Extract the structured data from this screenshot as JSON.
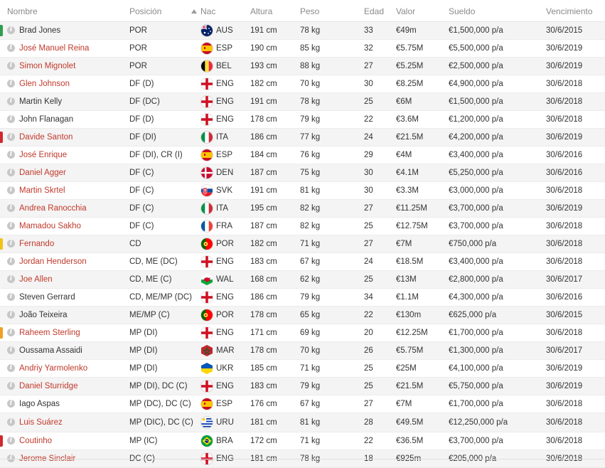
{
  "columns": {
    "name": "Nombre",
    "position": "Posición",
    "nationality": "Nac",
    "height": "Altura",
    "weight": "Peso",
    "age": "Edad",
    "value": "Valor",
    "wage": "Sueldo",
    "expiry": "Vencimiento"
  },
  "colors": {
    "link_name": "#c0392b",
    "plain_name": "#333333",
    "marker_green": "#2e9e4f",
    "marker_red": "#d0282e",
    "marker_yellow": "#f2c21b",
    "marker_orange": "#f0a020"
  },
  "players": [
    {
      "name": "Brad Jones",
      "link": false,
      "marker": "green",
      "position": "POR",
      "nat": "AUS",
      "flag": "aus",
      "height": "191 cm",
      "weight": "78 kg",
      "age": "33",
      "value": "€49m",
      "wage": "€1,500,000 p/a",
      "expiry": "30/6/2015"
    },
    {
      "name": "José Manuel Reina",
      "link": true,
      "marker": "",
      "position": "POR",
      "nat": "ESP",
      "flag": "esp",
      "height": "190 cm",
      "weight": "85 kg",
      "age": "32",
      "value": "€5.75M",
      "wage": "€5,500,000 p/a",
      "expiry": "30/6/2019"
    },
    {
      "name": "Simon Mignolet",
      "link": true,
      "marker": "",
      "position": "POR",
      "nat": "BEL",
      "flag": "bel",
      "height": "193 cm",
      "weight": "88 kg",
      "age": "27",
      "value": "€5.25M",
      "wage": "€2,500,000 p/a",
      "expiry": "30/6/2019"
    },
    {
      "name": "Glen Johnson",
      "link": true,
      "marker": "",
      "position": "DF (D)",
      "nat": "ENG",
      "flag": "eng",
      "height": "182 cm",
      "weight": "70 kg",
      "age": "30",
      "value": "€8.25M",
      "wage": "€4,900,000 p/a",
      "expiry": "30/6/2018"
    },
    {
      "name": "Martin Kelly",
      "link": false,
      "marker": "",
      "position": "DF (DC)",
      "nat": "ENG",
      "flag": "eng",
      "height": "191 cm",
      "weight": "78 kg",
      "age": "25",
      "value": "€6M",
      "wage": "€1,500,000 p/a",
      "expiry": "30/6/2018"
    },
    {
      "name": "John Flanagan",
      "link": false,
      "marker": "",
      "position": "DF (D)",
      "nat": "ENG",
      "flag": "eng",
      "height": "178 cm",
      "weight": "79 kg",
      "age": "22",
      "value": "€3.6M",
      "wage": "€1,200,000 p/a",
      "expiry": "30/6/2018"
    },
    {
      "name": "Davide Santon",
      "link": true,
      "marker": "red",
      "position": "DF (DI)",
      "nat": "ITA",
      "flag": "ita",
      "height": "186 cm",
      "weight": "77 kg",
      "age": "24",
      "value": "€21.5M",
      "wage": "€4,200,000 p/a",
      "expiry": "30/6/2019"
    },
    {
      "name": "José Enrique",
      "link": true,
      "marker": "",
      "position": "DF (DI), CR (I)",
      "nat": "ESP",
      "flag": "esp",
      "height": "184 cm",
      "weight": "76 kg",
      "age": "29",
      "value": "€4M",
      "wage": "€3,400,000 p/a",
      "expiry": "30/6/2016"
    },
    {
      "name": "Daniel Agger",
      "link": true,
      "marker": "",
      "position": "DF (C)",
      "nat": "DEN",
      "flag": "den",
      "height": "187 cm",
      "weight": "75 kg",
      "age": "30",
      "value": "€4.1M",
      "wage": "€5,250,000 p/a",
      "expiry": "30/6/2016"
    },
    {
      "name": "Martin Skrtel",
      "link": true,
      "marker": "",
      "position": "DF (C)",
      "nat": "SVK",
      "flag": "svk",
      "height": "191 cm",
      "weight": "81 kg",
      "age": "30",
      "value": "€3.3M",
      "wage": "€3,000,000 p/a",
      "expiry": "30/6/2018"
    },
    {
      "name": "Andrea Ranocchia",
      "link": true,
      "marker": "",
      "position": "DF (C)",
      "nat": "ITA",
      "flag": "ita",
      "height": "195 cm",
      "weight": "82 kg",
      "age": "27",
      "value": "€11.25M",
      "wage": "€3,700,000 p/a",
      "expiry": "30/6/2019"
    },
    {
      "name": "Mamadou Sakho",
      "link": true,
      "marker": "",
      "position": "DF (C)",
      "nat": "FRA",
      "flag": "fra",
      "height": "187 cm",
      "weight": "82 kg",
      "age": "25",
      "value": "€12.75M",
      "wage": "€3,700,000 p/a",
      "expiry": "30/6/2018"
    },
    {
      "name": "Fernando",
      "link": true,
      "marker": "yellow",
      "position": "CD",
      "nat": "POR",
      "flag": "por",
      "height": "182 cm",
      "weight": "71 kg",
      "age": "27",
      "value": "€7M",
      "wage": "€750,000 p/a",
      "expiry": "30/6/2018"
    },
    {
      "name": "Jordan Henderson",
      "link": true,
      "marker": "",
      "position": "CD, ME (DC)",
      "nat": "ENG",
      "flag": "eng",
      "height": "183 cm",
      "weight": "67 kg",
      "age": "24",
      "value": "€18.5M",
      "wage": "€3,400,000 p/a",
      "expiry": "30/6/2018"
    },
    {
      "name": "Joe Allen",
      "link": true,
      "marker": "",
      "position": "CD, ME (C)",
      "nat": "WAL",
      "flag": "wal",
      "height": "168 cm",
      "weight": "62 kg",
      "age": "25",
      "value": "€13M",
      "wage": "€2,800,000 p/a",
      "expiry": "30/6/2017"
    },
    {
      "name": "Steven Gerrard",
      "link": false,
      "marker": "",
      "position": "CD, ME/MP (DC)",
      "nat": "ENG",
      "flag": "eng",
      "height": "186 cm",
      "weight": "79 kg",
      "age": "34",
      "value": "€1.1M",
      "wage": "€4,300,000 p/a",
      "expiry": "30/6/2016"
    },
    {
      "name": "João Teixeira",
      "link": false,
      "marker": "",
      "position": "ME/MP (C)",
      "nat": "POR",
      "flag": "por",
      "height": "178 cm",
      "weight": "65 kg",
      "age": "22",
      "value": "€130m",
      "wage": "€625,000 p/a",
      "expiry": "30/6/2015"
    },
    {
      "name": "Raheem Sterling",
      "link": true,
      "marker": "orange",
      "position": "MP (DI)",
      "nat": "ENG",
      "flag": "eng",
      "height": "171 cm",
      "weight": "69 kg",
      "age": "20",
      "value": "€12.25M",
      "wage": "€1,700,000 p/a",
      "expiry": "30/6/2018"
    },
    {
      "name": "Oussama Assaidi",
      "link": false,
      "marker": "",
      "position": "MP (DI)",
      "nat": "MAR",
      "flag": "mar",
      "height": "178 cm",
      "weight": "70 kg",
      "age": "26",
      "value": "€5.75M",
      "wage": "€1,300,000 p/a",
      "expiry": "30/6/2017"
    },
    {
      "name": "Andriy Yarmolenko",
      "link": true,
      "marker": "",
      "position": "MP (DI)",
      "nat": "UKR",
      "flag": "ukr",
      "height": "185 cm",
      "weight": "71 kg",
      "age": "25",
      "value": "€25M",
      "wage": "€4,100,000 p/a",
      "expiry": "30/6/2019"
    },
    {
      "name": "Daniel Sturridge",
      "link": true,
      "marker": "",
      "position": "MP (DI), DC (C)",
      "nat": "ENG",
      "flag": "eng",
      "height": "183 cm",
      "weight": "79 kg",
      "age": "25",
      "value": "€21.5M",
      "wage": "€5,750,000 p/a",
      "expiry": "30/6/2019"
    },
    {
      "name": "Iago Aspas",
      "link": false,
      "marker": "",
      "position": "MP (DC), DC (C)",
      "nat": "ESP",
      "flag": "esp",
      "height": "176 cm",
      "weight": "67 kg",
      "age": "27",
      "value": "€7M",
      "wage": "€1,700,000 p/a",
      "expiry": "30/6/2018"
    },
    {
      "name": "Luis Suárez",
      "link": true,
      "marker": "",
      "tall": true,
      "position": "MP (DIC), DC (C)",
      "nat": "URU",
      "flag": "uru",
      "height": "181 cm",
      "weight": "81 kg",
      "age": "28",
      "value": "€49.5M",
      "wage": "€12,250,000 p/a",
      "expiry": "30/6/2018"
    },
    {
      "name": "Coutinho",
      "link": true,
      "marker": "red",
      "position": "MP (IC)",
      "nat": "BRA",
      "flag": "bra",
      "height": "172 cm",
      "weight": "71 kg",
      "age": "22",
      "value": "€36.5M",
      "wage": "€3,700,000 p/a",
      "expiry": "30/6/2018"
    },
    {
      "name": "Jerome Sinclair",
      "link": true,
      "marker": "",
      "position": "DC (C)",
      "nat": "ENG",
      "flag": "eng",
      "height": "181 cm",
      "weight": "78 kg",
      "age": "18",
      "value": "€925m",
      "wage": "€205,000 p/a",
      "expiry": "30/6/2018"
    }
  ]
}
